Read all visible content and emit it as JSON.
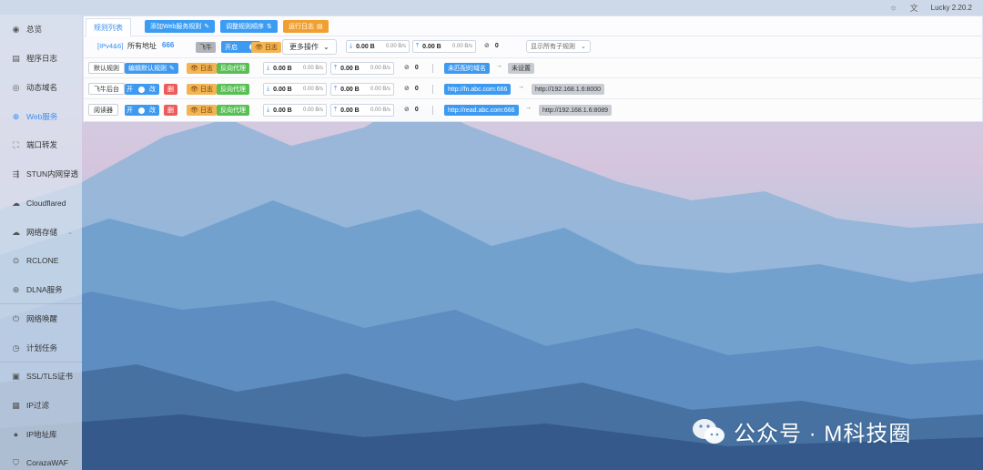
{
  "topbar": {
    "version": "Lucky 2.20.2"
  },
  "sidebar": {
    "items": [
      {
        "label": "总览",
        "icon": "dashboard-icon"
      },
      {
        "label": "程序日志",
        "icon": "log-icon"
      },
      {
        "label": "动态域名",
        "icon": "ddns-icon"
      },
      {
        "label": "Web服务",
        "icon": "globe-icon",
        "active": true
      },
      {
        "label": "端口转发",
        "icon": "port-forward-icon"
      },
      {
        "label": "STUN内网穿透",
        "icon": "stun-icon"
      },
      {
        "label": "Cloudflared",
        "icon": "cloud-icon"
      },
      {
        "label": "网络存储",
        "icon": "storage-icon"
      },
      {
        "label": "RCLONE",
        "icon": "rclone-icon"
      },
      {
        "label": "DLNA服务",
        "icon": "dlna-icon"
      },
      {
        "label": "网络唤醒",
        "icon": "wol-icon"
      },
      {
        "label": "计划任务",
        "icon": "clock-icon"
      },
      {
        "label": "SSL/TLS证书",
        "icon": "certificate-icon"
      },
      {
        "label": "IP过滤",
        "icon": "filter-icon"
      },
      {
        "label": "IP地址库",
        "icon": "person-icon"
      },
      {
        "label": "CorazaWAF",
        "icon": "shield-icon"
      }
    ]
  },
  "toolbar": {
    "tab_rules": "规则列表",
    "add_rule": "添加Web服务规则",
    "reorder": "调整规则顺序",
    "run_log": "运行日志"
  },
  "listener": {
    "ip_type": "[IPv4&6]",
    "address": "所有地址",
    "port": "666",
    "feiniu": "飞牛",
    "enabled": "开启",
    "log": "日志",
    "more": "更多操作",
    "down": "0.00 B",
    "down_rate": "0.00 B/s",
    "up": "0.00 B",
    "up_rate": "0.00 B/s",
    "conns": "0",
    "show_sub": "显示所有子规则"
  },
  "rules": [
    {
      "name": "默认规则",
      "edit": "编辑默认规则",
      "log": "日志",
      "type": "反向代理",
      "down": "0.00 B",
      "down_rate": "0.00 B/s",
      "up": "0.00 B",
      "up_rate": "0.00 B/s",
      "conns": "0",
      "domain": "未匹配的域名",
      "target": "未设置"
    },
    {
      "name": "飞牛后台",
      "toggle": "开",
      "edit": "改",
      "del": "删",
      "log": "日志",
      "type": "反向代理",
      "down": "0.00 B",
      "down_rate": "0.00 B/s",
      "up": "0.00 B",
      "up_rate": "0.00 B/s",
      "conns": "0",
      "domain": "http://fn.abc.com:666",
      "target": "http://192.168.1.6:8000"
    },
    {
      "name": "阅读器",
      "toggle": "开",
      "edit": "改",
      "del": "删",
      "log": "日志",
      "type": "反向代理",
      "down": "0.00 B",
      "down_rate": "0.00 B/s",
      "up": "0.00 B",
      "up_rate": "0.00 B/s",
      "conns": "0",
      "domain": "http://read.abc.com:666",
      "target": "http://192.168.1.6:8089"
    }
  ],
  "watermark": {
    "text": "公众号 · M科技圈"
  }
}
